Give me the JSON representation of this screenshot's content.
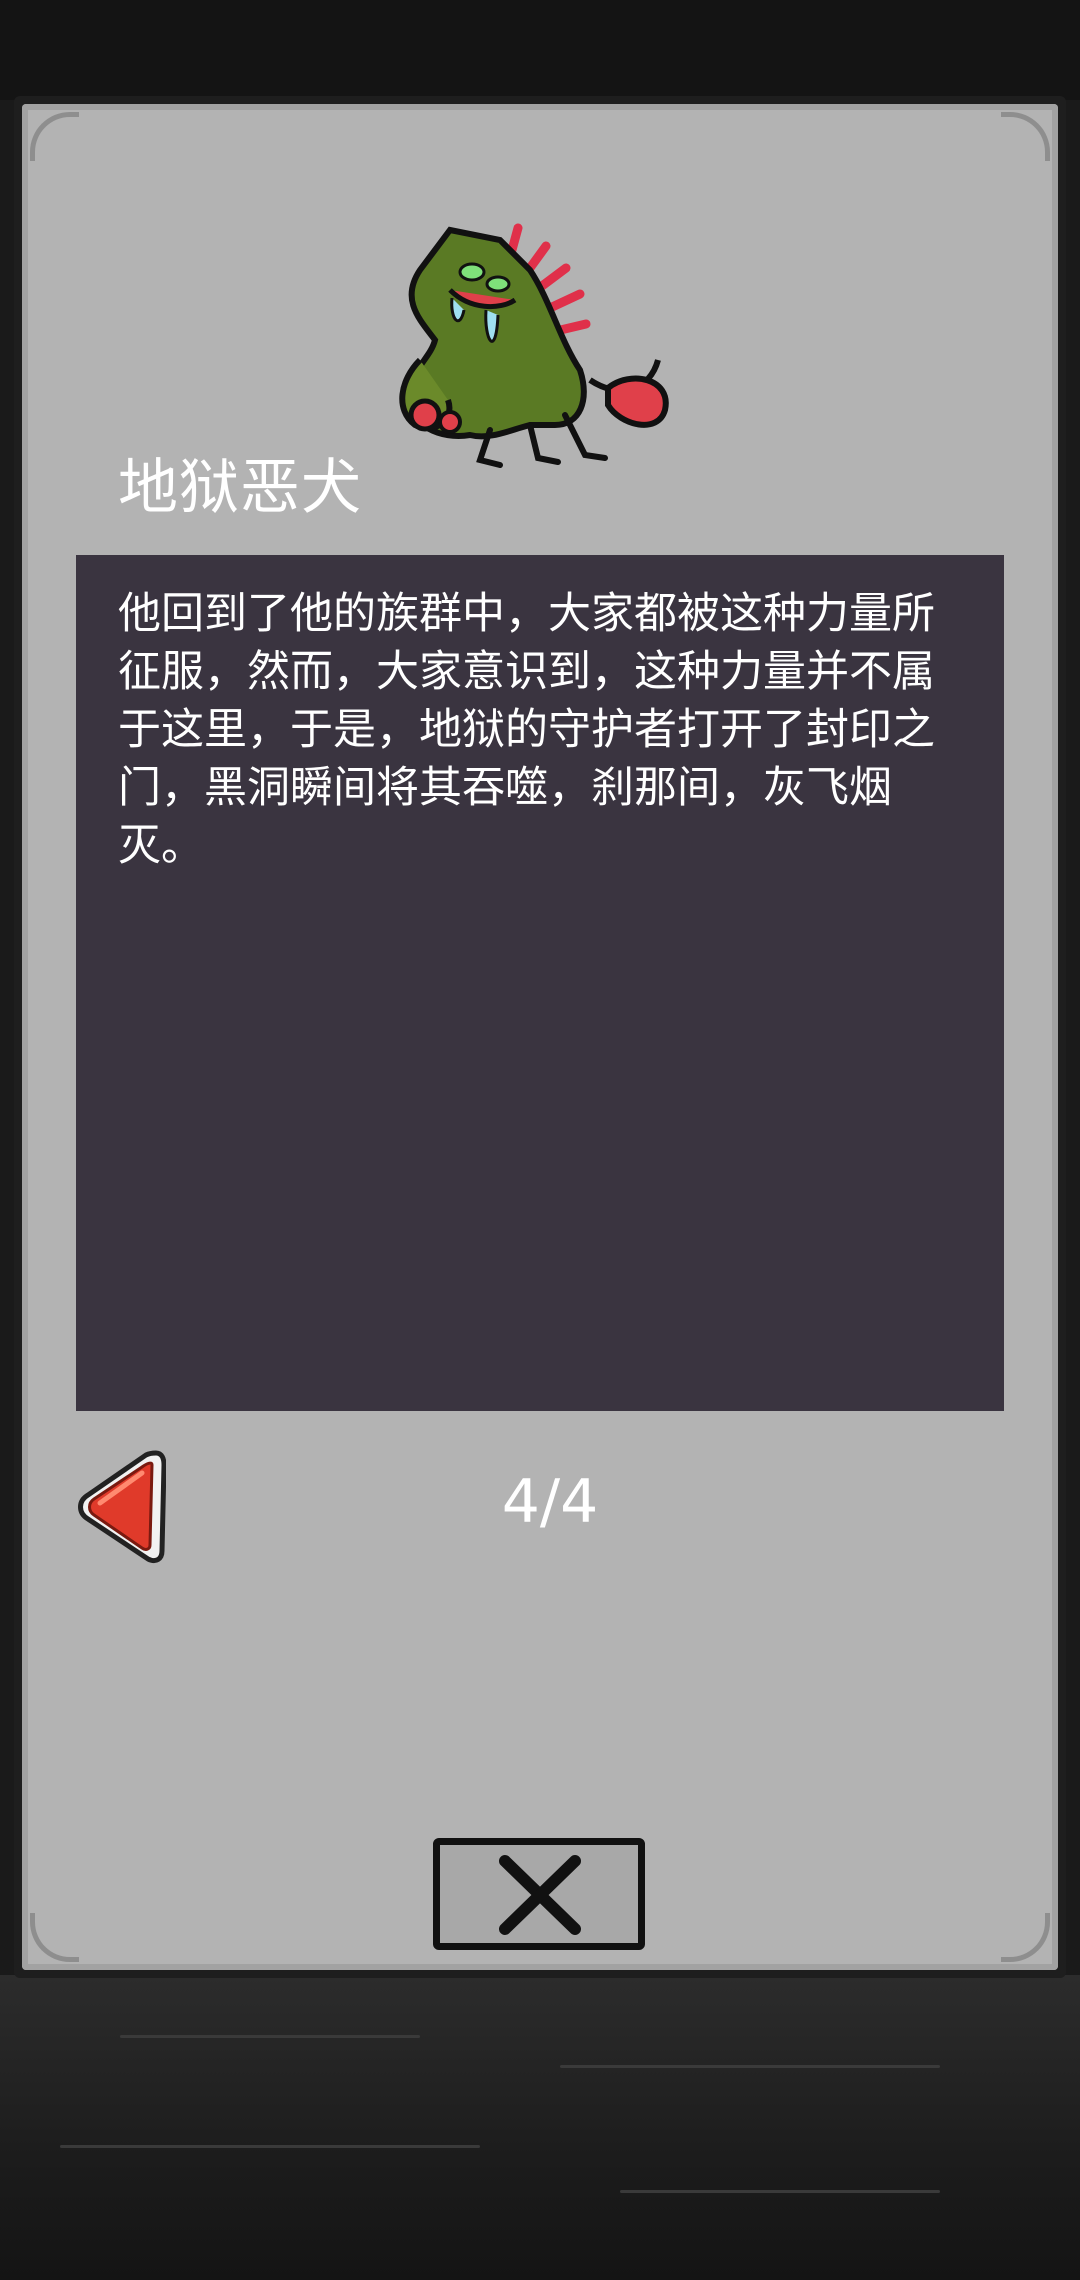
{
  "monster": {
    "name": "地狱恶犬",
    "icon": "hellhound-monster-icon"
  },
  "description": {
    "text": "他回到了他的族群中，大家都被这种力量所征服，然而，大家意识到，这种力量并不属于这里，于是，地狱的守护者打开了封印之门，黑洞瞬间将其吞噬，刹那间，灰飞烟灭。"
  },
  "pagination": {
    "label": "4/4",
    "current": 4,
    "total": 4,
    "prev_icon": "red-left-arrow-icon"
  },
  "close": {
    "icon": "close-x-icon"
  },
  "colors": {
    "panel": "#b3b3b3",
    "description_bg": "#3a3440",
    "text": "#ffffff",
    "arrow": "#e03a2a"
  }
}
